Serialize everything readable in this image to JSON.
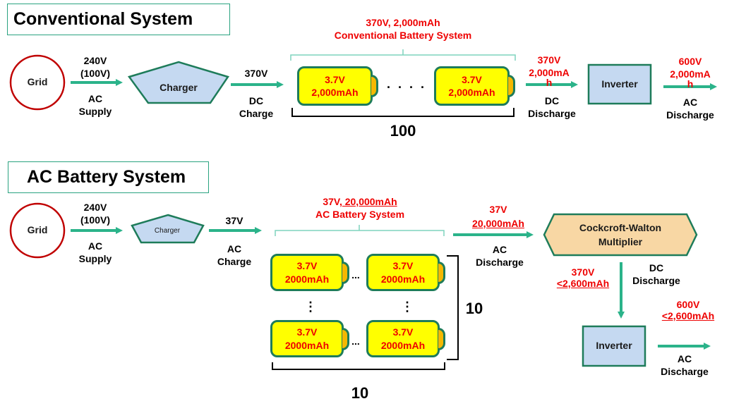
{
  "conventional": {
    "title": "Conventional System",
    "grid_label": "Grid",
    "supply_voltage": "240V",
    "supply_voltage_alt": "(100V)",
    "supply_type_1": "AC",
    "supply_type_2": "Supply",
    "charger_label": "Charger",
    "charge_voltage": "370V",
    "charge_type_1": "DC",
    "charge_type_2": "Charge",
    "pack_spec": "370V, 2,000mAh",
    "pack_name": "Conventional  Battery System",
    "cells": [
      {
        "voltage": "3.7V",
        "capacity": "2,000mAh"
      },
      {
        "voltage": "3.7V",
        "capacity": "2,000mAh"
      }
    ],
    "cell_ellipsis": ". . . .",
    "cell_count": "100",
    "dc_out_voltage": "370V",
    "dc_out_capacity": "2,000mA",
    "dc_out_capacity_wrap": "h",
    "dc_out_type_1": "DC",
    "dc_out_type_2": "Discharge",
    "inverter_label": "Inverter",
    "ac_out_voltage": "600V",
    "ac_out_capacity": "2,000mA",
    "ac_out_capacity_wrap": "h",
    "ac_out_type_1": "AC",
    "ac_out_type_2": "Discharge"
  },
  "ac_system": {
    "title": "AC Battery System",
    "grid_label": "Grid",
    "supply_voltage": "240V",
    "supply_voltage_alt": "(100V)",
    "supply_type_1": "AC",
    "supply_type_2": "Supply",
    "charger_label": "Charger",
    "charge_voltage": "37V",
    "charge_type_1": "AC",
    "charge_type_2": "Charge",
    "pack_spec_voltage": "37V,",
    "pack_spec_capacity": " 20,000mAh",
    "pack_name": "AC Battery System",
    "cells": [
      {
        "voltage": "3.7V",
        "capacity": "2000mAh"
      },
      {
        "voltage": "3.7V",
        "capacity": "2000mAh"
      },
      {
        "voltage": "3.7V",
        "capacity": "2000mAh"
      },
      {
        "voltage": "3.7V",
        "capacity": "2000mAh"
      }
    ],
    "h_ellipsis": "...",
    "v_ellipsis": "⋮",
    "rows_count": "10",
    "cols_count": "10",
    "ac_out_voltage": "37V",
    "ac_out_capacity": "20,000mAh",
    "ac_out_type_1": "AC",
    "ac_out_type_2": "Discharge",
    "multiplier_label_1": "Cockcroft-Walton",
    "multiplier_label_2": "Multiplier",
    "dc_voltage": "370V",
    "dc_capacity": "<2,600mAh",
    "dc_type_1": "DC",
    "dc_type_2": "Discharge",
    "inverter_label": "Inverter",
    "final_voltage": "600V",
    "final_capacity": "<2,600mAh",
    "final_type_1": "AC",
    "final_type_2": "Discharge"
  },
  "colors": {
    "arrow": "#2bb38a",
    "outline": "#1e7c5a",
    "grid_ring": "#c00000",
    "charger_fill": "#c5d9f1",
    "battery_fill": "#ffff00",
    "battery_cap": "#f5b800",
    "multiplier_fill": "#f8d7a4",
    "spec_text": "#ee0000"
  }
}
